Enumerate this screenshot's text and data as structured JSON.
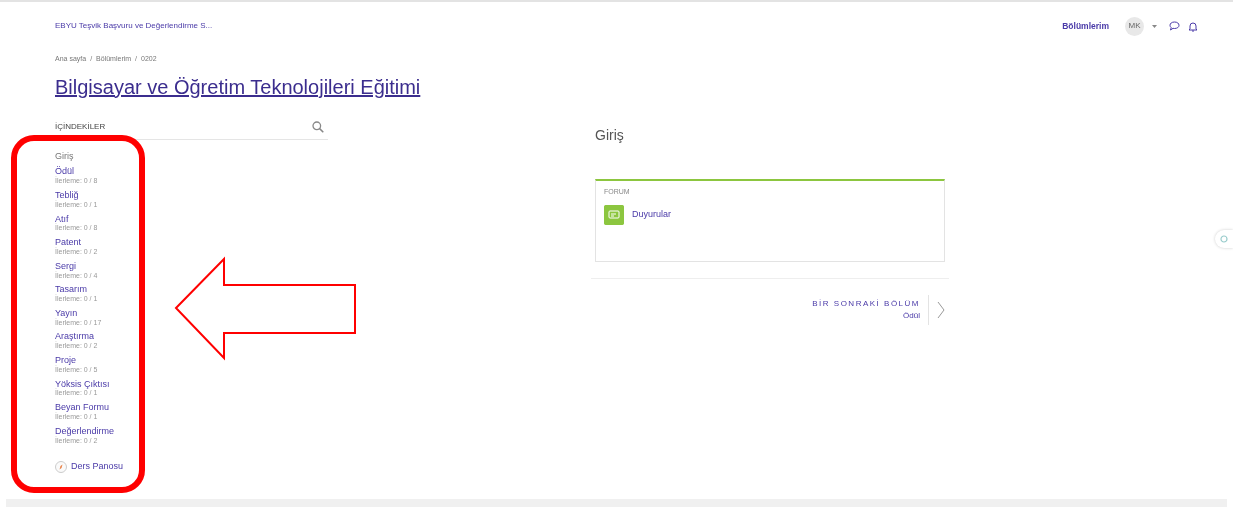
{
  "navbar": {
    "site_name": "EBYU Teşvik Başvuru ve Değerlendirme S...",
    "link": "Bölümlerim",
    "avatar": "MK"
  },
  "breadcrumb": [
    {
      "label": "Ana sayfa"
    },
    {
      "separator": "/",
      "label": "Bölümlerim"
    },
    {
      "separator": "/",
      "label": "0202"
    }
  ],
  "title": "Bilgisayar ve Öğretim Teknolojileri Eğitimi",
  "sidebar": {
    "heading": "İÇİNDEKİLER",
    "items": [
      {
        "label": "Giriş",
        "selected": true
      },
      {
        "label": "Ödül",
        "progress": "İlerleme: 0 / 8",
        "selected": false
      },
      {
        "label": "Tebliğ",
        "progress": "İlerleme: 0 / 1",
        "selected": false
      },
      {
        "label": "Atıf",
        "progress": "İlerleme: 0 / 8",
        "selected": false
      },
      {
        "label": "Patent",
        "progress": "İlerleme: 0 / 2",
        "selected": false
      },
      {
        "label": "Sergi",
        "progress": "İlerleme: 0 / 4",
        "selected": false
      },
      {
        "label": "Tasarım",
        "progress": "İlerleme: 0 / 1",
        "selected": false
      },
      {
        "label": "Yayın",
        "progress": "İlerleme: 0 / 17",
        "selected": false
      },
      {
        "label": "Araştırma",
        "progress": "İlerleme: 0 / 2",
        "selected": false
      },
      {
        "label": "Proje",
        "progress": "İlerleme: 0 / 5",
        "selected": false
      },
      {
        "label": "Yöksis Çıktısı",
        "progress": "İlerleme: 0 / 1",
        "selected": false
      },
      {
        "label": "Beyan Formu",
        "progress": "İlerleme: 0 / 1",
        "selected": false
      },
      {
        "label": "Değerlendirme",
        "progress": "İlerleme: 0 / 2",
        "selected": false
      }
    ],
    "dashboard_link": "Ders Panosu"
  },
  "section": {
    "title": "Giriş",
    "activity": {
      "type": "FORUM",
      "name": "Duyurular"
    },
    "next": {
      "label": "BİR SONRAKİ BÖLÜM",
      "name": "Ödül"
    }
  }
}
